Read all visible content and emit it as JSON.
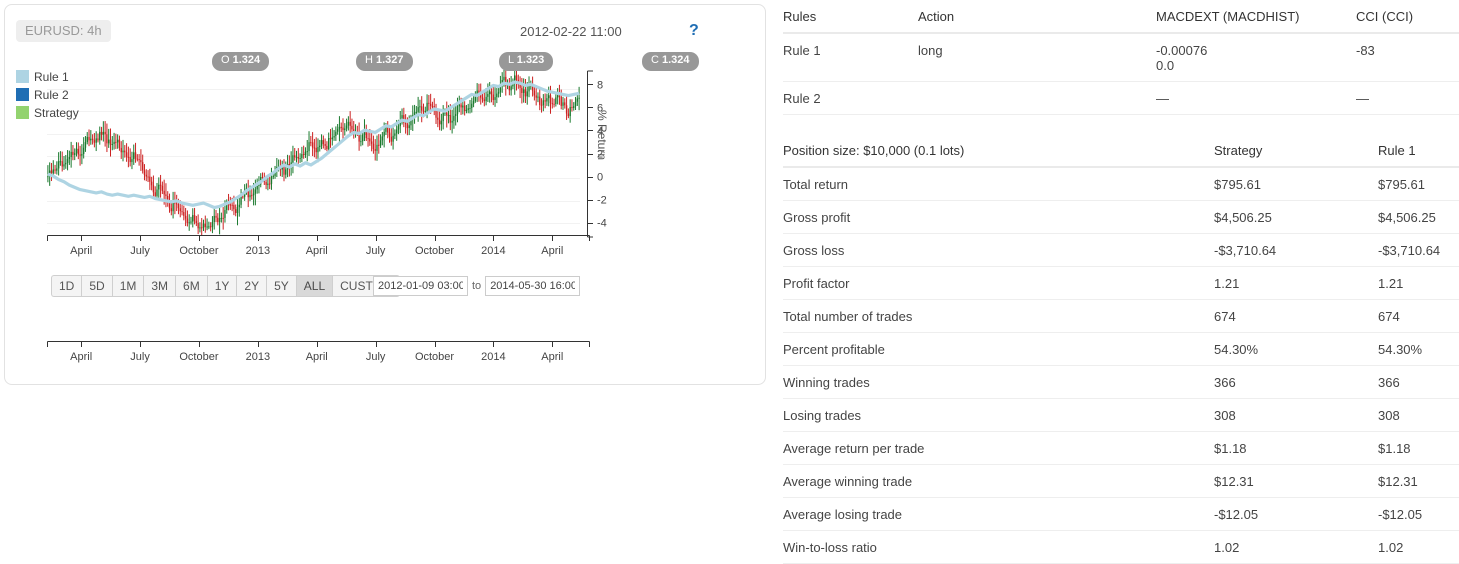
{
  "chart": {
    "symbol_badge": "EURUSD: 4h",
    "timestamp": "2012-02-22 11:00",
    "help_icon": "?",
    "ohlc": [
      {
        "key": "O",
        "value": "1.324"
      },
      {
        "key": "H",
        "value": "1.327"
      },
      {
        "key": "L",
        "value": "1.323"
      },
      {
        "key": "C",
        "value": "1.324"
      }
    ],
    "legend": [
      {
        "label": "Rule 1",
        "color": "#aed4e3"
      },
      {
        "label": "Rule 2",
        "color": "#1f6eb4"
      },
      {
        "label": "Strategy",
        "color": "#93d36f"
      }
    ],
    "range_buttons": [
      {
        "label": "1D",
        "active": false
      },
      {
        "label": "5D",
        "active": false
      },
      {
        "label": "1M",
        "active": false
      },
      {
        "label": "3M",
        "active": false
      },
      {
        "label": "6M",
        "active": false
      },
      {
        "label": "1Y",
        "active": false
      },
      {
        "label": "2Y",
        "active": false
      },
      {
        "label": "5Y",
        "active": false
      },
      {
        "label": "ALL",
        "active": true
      },
      {
        "label": "CUSTOM",
        "active": false
      }
    ],
    "date_from": "2012-01-09 03:00",
    "date_to": "2014-05-30 16:00",
    "date_separator": "to"
  },
  "chart_data": {
    "type": "line",
    "title": "EURUSD: 4h",
    "xlabel": "",
    "ylabel": "% Return",
    "ylim": [
      -5.5,
      9.5
    ],
    "yticks": [
      8,
      6,
      4,
      2,
      0,
      -2,
      -4
    ],
    "xticks": [
      "April",
      "July",
      "October",
      "2013",
      "April",
      "July",
      "October",
      "2014",
      "April"
    ],
    "grid": true,
    "legend_position": "top-left",
    "x_range": [
      "2012-01-09 03:00",
      "2014-05-30 16:00"
    ],
    "series": [
      {
        "name": "Price (candlesticks)",
        "type": "candlestick",
        "up_color": "#1a7a2e",
        "down_color": "#cc2222",
        "values": [
          0.2,
          0.6,
          1.3,
          0.9,
          1.8,
          2.6,
          2.1,
          3.1,
          3.8,
          3.2,
          4.1,
          3.4,
          2.7,
          3.3,
          2.4,
          1.6,
          2.2,
          1.4,
          0.6,
          -0.4,
          -1.3,
          -0.6,
          -1.8,
          -2.7,
          -2.1,
          -3.2,
          -4.1,
          -3.4,
          -4.6,
          -3.8,
          -4.4,
          -3.1,
          -3.9,
          -2.8,
          -2.1,
          -2.9,
          -1.9,
          -1.1,
          -1.8,
          -0.8,
          0.1,
          -0.6,
          0.5,
          1.2,
          0.4,
          1.4,
          2.2,
          1.5,
          2.4,
          3.2,
          2.6,
          3.6,
          2.9,
          3.9,
          4.6,
          4.0,
          4.9,
          4.2,
          3.4,
          4.1,
          3.3,
          2.6,
          3.4,
          4.2,
          3.6,
          4.5,
          5.3,
          4.7,
          5.6,
          6.4,
          5.8,
          6.7,
          6.0,
          5.2,
          5.9,
          5.1,
          5.8,
          6.6,
          6.0,
          6.9,
          7.6,
          7.0,
          7.8,
          7.2,
          8.0,
          8.7,
          8.1,
          8.9,
          8.2,
          7.5,
          8.2,
          7.4,
          6.7,
          7.3,
          6.6,
          7.2,
          6.5,
          5.9,
          6.6,
          7.2
        ]
      },
      {
        "name": "Rule 1",
        "type": "line",
        "color": "#aed4e3",
        "values": [
          0.4,
          0.2,
          -0.1,
          -0.3,
          -0.6,
          -0.8,
          -1.0,
          -1.1,
          -1.2,
          -1.3,
          -1.2,
          -1.4,
          -1.5,
          -1.4,
          -1.5,
          -1.6,
          -1.5,
          -1.6,
          -1.7,
          -1.6,
          -1.8,
          -1.9,
          -2.0,
          -2.1,
          -2.0,
          -2.2,
          -2.3,
          -2.4,
          -2.3,
          -2.2,
          -2.4,
          -2.6,
          -2.5,
          -2.3,
          -2.1,
          -1.8,
          -1.5,
          -1.1,
          -0.8,
          -0.5,
          -0.2,
          0.2,
          0.5,
          0.9,
          1.2,
          1.0,
          1.3,
          1.1,
          1.4,
          1.2,
          1.5,
          1.8,
          2.2,
          2.6,
          3.0,
          3.4,
          3.8,
          4.1,
          4.0,
          4.3,
          4.2,
          4.1,
          4.4,
          4.7,
          4.6,
          4.9,
          5.2,
          5.1,
          5.4,
          5.7,
          5.6,
          5.9,
          6.2,
          6.1,
          6.0,
          6.3,
          6.6,
          6.9,
          7.2,
          7.5,
          7.4,
          7.7,
          8.0,
          8.3,
          8.2,
          8.5,
          8.4,
          8.6,
          8.5,
          8.3,
          8.4,
          8.2,
          8.0,
          7.8,
          7.7,
          7.6,
          7.5,
          7.4,
          7.5,
          7.6
        ]
      }
    ]
  },
  "rules_table": {
    "headers": [
      "Rules",
      "Action",
      "MACDEXT (MACDHIST)",
      "CCI (CCI)"
    ],
    "rows": [
      {
        "rule": "Rule 1",
        "action": "long",
        "ind1_line1": "-0.00076",
        "ind1_line2": "0.0",
        "ind2": "-83"
      },
      {
        "rule": "Rule 2",
        "action": "",
        "ind1_line1": "—",
        "ind1_line2": "",
        "ind2": "—"
      }
    ]
  },
  "stats_table": {
    "headers": [
      "Position size: $10,000 (0.1 lots)",
      "Strategy",
      "Rule 1"
    ],
    "rows": [
      {
        "label": "Total return",
        "strategy": "$795.61",
        "rule1": "$795.61",
        "negative": false
      },
      {
        "label": "Gross profit",
        "strategy": "$4,506.25",
        "rule1": "$4,506.25",
        "negative": false
      },
      {
        "label": "Gross loss",
        "strategy": "-$3,710.64",
        "rule1": "-$3,710.64",
        "negative": true
      },
      {
        "label": "Profit factor",
        "strategy": "1.21",
        "rule1": "1.21",
        "negative": false
      },
      {
        "label": "Total number of trades",
        "strategy": "674",
        "rule1": "674",
        "negative": false
      },
      {
        "label": "Percent profitable",
        "strategy": "54.30%",
        "rule1": "54.30%",
        "negative": false
      },
      {
        "label": "Winning trades",
        "strategy": "366",
        "rule1": "366",
        "negative": false
      },
      {
        "label": "Losing trades",
        "strategy": "308",
        "rule1": "308",
        "negative": false
      },
      {
        "label": "Average return per trade",
        "strategy": "$1.18",
        "rule1": "$1.18",
        "negative": false
      },
      {
        "label": "Average winning trade",
        "strategy": "$12.31",
        "rule1": "$12.31",
        "negative": false
      },
      {
        "label": "Average losing trade",
        "strategy": "-$12.05",
        "rule1": "-$12.05",
        "negative": true
      },
      {
        "label": "Win-to-loss ratio",
        "strategy": "1.02",
        "rule1": "1.02",
        "negative": false
      }
    ]
  },
  "colors": {
    "loss_red": "#ee3b2c",
    "help_blue": "#1f6eb4",
    "badge_gray": "#989898"
  }
}
